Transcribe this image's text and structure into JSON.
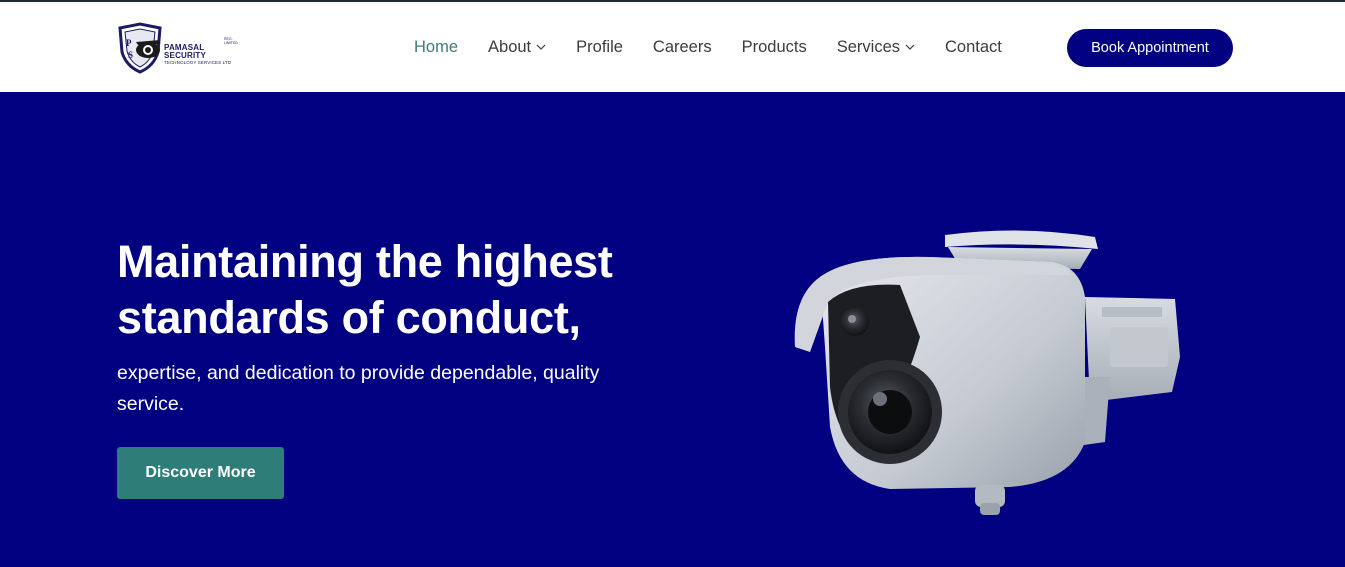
{
  "brand": {
    "logo_line0": "REG. LIMITED",
    "logo_line1": "PAMASAL SECURITY",
    "logo_line2": "TECHNOLOGY SERVICES LTD"
  },
  "nav": {
    "items": [
      {
        "label": "Home",
        "active": true,
        "dropdown": false
      },
      {
        "label": "About",
        "active": false,
        "dropdown": true
      },
      {
        "label": "Profile",
        "active": false,
        "dropdown": false
      },
      {
        "label": "Careers",
        "active": false,
        "dropdown": false
      },
      {
        "label": "Products",
        "active": false,
        "dropdown": false
      },
      {
        "label": "Services",
        "active": false,
        "dropdown": true
      },
      {
        "label": "Contact",
        "active": false,
        "dropdown": false
      }
    ],
    "cta_label": "Book Appointment"
  },
  "hero": {
    "title": "Maintaining the highest standards of conduct,",
    "subtitle": "expertise, and dedication to provide dependable, quality service.",
    "button_label": "Discover More"
  },
  "colors": {
    "hero_bg": "#000080",
    "accent_teal": "#2e7d78",
    "nav_active": "#3f7a7a",
    "cta_bg": "#000080"
  },
  "icons": {
    "dropdown": "chevron-down-icon",
    "hero_image": "security-camera-icon"
  }
}
